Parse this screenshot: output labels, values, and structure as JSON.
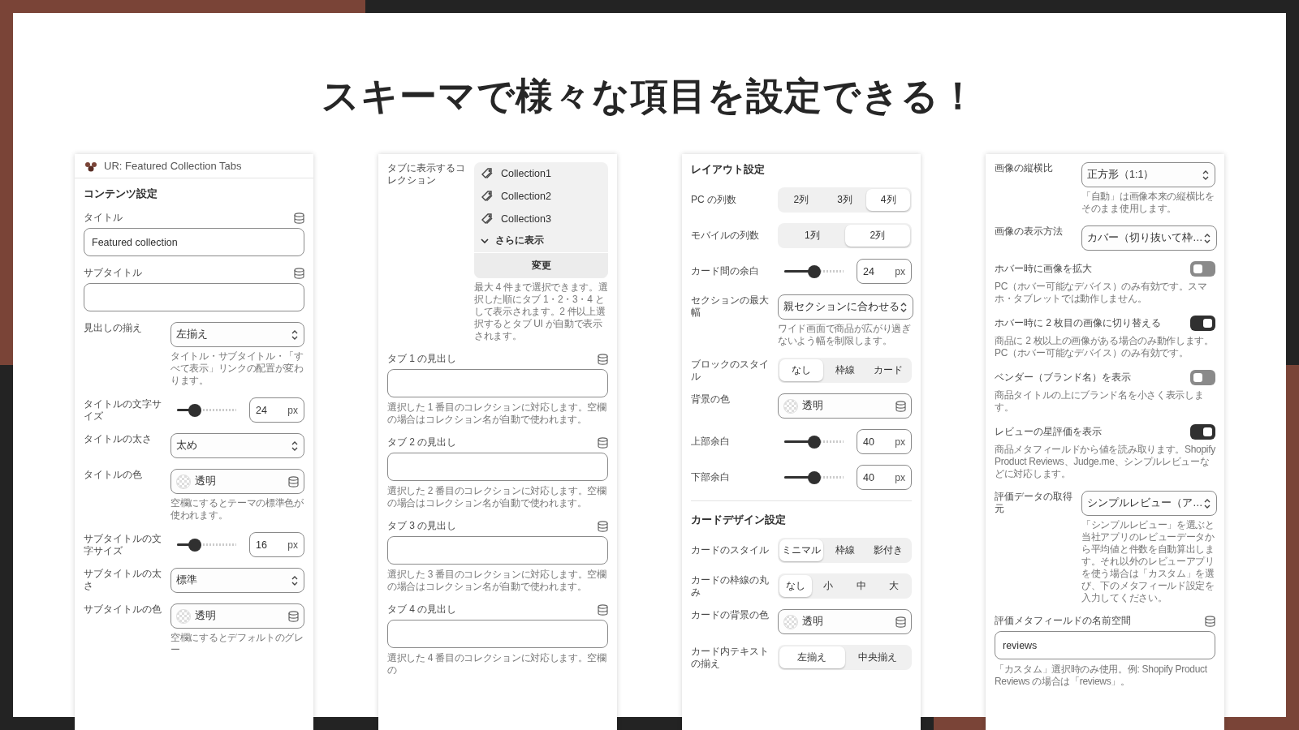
{
  "title": "スキーマで様々な項目を設定できる！",
  "panels": [
    {
      "header": "UR: Featured Collection Tabs",
      "fields": [
        {
          "kind": "heading",
          "text": "コンテンツ設定"
        },
        {
          "kind": "text",
          "label": "タイトル",
          "value": "Featured collection"
        },
        {
          "kind": "text",
          "label": "サブタイトル"
        },
        {
          "kind": "select",
          "label": "見出しの揃え",
          "value": "左揃え",
          "hint": "タイトル・サブタイトル・「すべて表示」リンクの配置が変わります。"
        },
        {
          "kind": "slider",
          "label": "タイトルの文字サイズ",
          "level": 0.3,
          "value": "24",
          "unit": "px"
        },
        {
          "kind": "select",
          "label": "タイトルの太さ",
          "value": "太め"
        },
        {
          "kind": "color",
          "label": "タイトルの色",
          "value": "透明",
          "hint": "空欄にするとテーマの標準色が使われます。"
        },
        {
          "kind": "slider",
          "label": "サブタイトルの文字サイズ",
          "level": 0.3,
          "value": "16",
          "unit": "px"
        },
        {
          "kind": "select",
          "label": "サブタイトルの太さ",
          "value": "標準"
        },
        {
          "kind": "color",
          "label": "サブタイトルの色",
          "value": "透明",
          "hint": "空欄にするとデフォルトのグレー"
        }
      ]
    },
    {
      "fields": [
        {
          "kind": "collections",
          "label": "タブに表示するコレクション",
          "items": [
            "Collection1",
            "Collection2",
            "Collection3"
          ],
          "more": "さらに表示",
          "action": "変更",
          "hint": "最大 4 件まで選択できます。選択した順にタブ 1・2・3・4 として表示されます。2 件以上選択するとタブ UI が自動で表示されます。"
        },
        {
          "kind": "text",
          "label": "タブ 1 の見出し",
          "hint": "選択した 1 番目のコレクションに対応します。空欄の場合はコレクション名が自動で使われます。"
        },
        {
          "kind": "text",
          "label": "タブ 2 の見出し",
          "hint": "選択した 2 番目のコレクションに対応します。空欄の場合はコレクション名が自動で使われます。"
        },
        {
          "kind": "text",
          "label": "タブ 3 の見出し",
          "hint": "選択した 3 番目のコレクションに対応します。空欄の場合はコレクション名が自動で使われます。"
        },
        {
          "kind": "text",
          "label": "タブ 4 の見出し",
          "hint": "選択した 4 番目のコレクションに対応します。空欄の"
        }
      ]
    },
    {
      "fields": [
        {
          "kind": "heading",
          "text": "レイアウト設定"
        },
        {
          "kind": "segmented",
          "label": "PC の列数",
          "options": [
            {
              "label": "2列",
              "selected": false
            },
            {
              "label": "3列",
              "selected": false
            },
            {
              "label": "4列",
              "selected": true
            }
          ]
        },
        {
          "kind": "segmented",
          "label": "モバイルの列数",
          "options": [
            {
              "label": "1列",
              "selected": false
            },
            {
              "label": "2列",
              "selected": true
            }
          ]
        },
        {
          "kind": "slider",
          "label": "カード間の余白",
          "level": 0.5,
          "value": "24",
          "unit": "px"
        },
        {
          "kind": "select",
          "label": "セクションの最大幅",
          "value": "親セクションに合わせる",
          "hint": "ワイド画面で商品が広がり過ぎないよう幅を制限します。"
        },
        {
          "kind": "segmented",
          "label": "ブロックのスタイル",
          "options": [
            {
              "label": "なし",
              "selected": true
            },
            {
              "label": "枠線",
              "selected": false
            },
            {
              "label": "カード",
              "selected": false
            }
          ]
        },
        {
          "kind": "color",
          "label": "背景の色",
          "value": "透明"
        },
        {
          "kind": "slider",
          "label": "上部余白",
          "level": 0.5,
          "value": "40",
          "unit": "px"
        },
        {
          "kind": "slider",
          "label": "下部余白",
          "level": 0.5,
          "value": "40",
          "unit": "px"
        },
        {
          "kind": "heading",
          "text": "カードデザイン設定"
        },
        {
          "kind": "segmented",
          "label": "カードのスタイル",
          "options": [
            {
              "label": "ミニマル",
              "selected": true
            },
            {
              "label": "枠線",
              "selected": false
            },
            {
              "label": "影付き",
              "selected": false
            }
          ]
        },
        {
          "kind": "segmented",
          "label": "カードの枠線の丸み",
          "options": [
            {
              "label": "なし",
              "selected": true
            },
            {
              "label": "小",
              "selected": false
            },
            {
              "label": "中",
              "selected": false
            },
            {
              "label": "大",
              "selected": false
            }
          ]
        },
        {
          "kind": "color",
          "label": "カードの背景の色",
          "value": "透明"
        },
        {
          "kind": "segmented",
          "label": "カード内テキストの揃え",
          "options": [
            {
              "label": "左揃え",
              "selected": true
            },
            {
              "label": "中央揃え",
              "selected": false
            }
          ]
        }
      ]
    },
    {
      "fields": [
        {
          "kind": "select",
          "label": "画像の縦横比",
          "value": "正方形（1:1）",
          "hint": "「自動」は画像本来の縦横比をそのまま使用します。"
        },
        {
          "kind": "select",
          "label": "画像の表示方法",
          "value": "カバー（切り抜いて枠…"
        },
        {
          "kind": "toggle",
          "label": "ホバー時に画像を拡大",
          "on": false,
          "hint": "PC（ホバー可能なデバイス）のみ有効です。スマホ・タブレットでは動作しません。"
        },
        {
          "kind": "toggle",
          "label": "ホバー時に 2 枚目の画像に切り替える",
          "on": true,
          "hint": "商品に 2 枚以上の画像がある場合のみ動作します。PC（ホバー可能なデバイス）のみ有効です。"
        },
        {
          "kind": "toggle",
          "label": "ベンダー（ブランド名）を表示",
          "on": false,
          "hint": "商品タイトルの上にブランド名を小さく表示します。"
        },
        {
          "kind": "toggle",
          "label": "レビューの星評価を表示",
          "on": true,
          "hint": "商品メタフィールドから値を読み取ります。Shopify Product Reviews、Judge.me、シンプルレビューなどに対応します。"
        },
        {
          "kind": "select",
          "label": "評価データの取得元",
          "value": "シンプルレビュー（ア…",
          "hint": "「シンプルレビュー」を選ぶと当社アプリのレビューデータから平均値と件数を自動算出します。それ以外のレビューアプリを使う場合は「カスタム」を選び、下のメタフィールド設定を入力してください。"
        },
        {
          "kind": "text",
          "label": "評価メタフィールドの名前空間",
          "value": "reviews",
          "hint": "「カスタム」選択時のみ使用。例: Shopify Product Reviews の場合は「reviews」。"
        }
      ]
    }
  ]
}
